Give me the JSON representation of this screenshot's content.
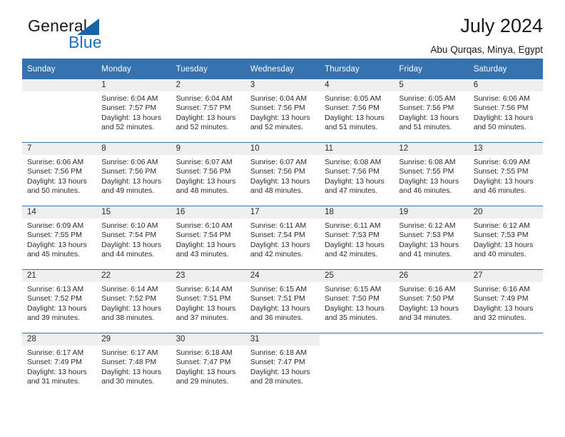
{
  "brand": {
    "name_part1": "General",
    "name_part2": "Blue",
    "triangle_icon": "triangle-icon",
    "accent_color": "#1764ab",
    "text_color": "#1a1a1a"
  },
  "header": {
    "title": "July 2024",
    "location": "Abu Qurqas, Minya, Egypt"
  },
  "theme": {
    "header_blue": "#3572b0",
    "daynum_band": "#efefef",
    "body_text": "#2b2b2b"
  },
  "calendar": {
    "weekday_headers": [
      "Sunday",
      "Monday",
      "Tuesday",
      "Wednesday",
      "Thursday",
      "Friday",
      "Saturday"
    ],
    "labels": {
      "sunrise": "Sunrise:",
      "sunset": "Sunset:",
      "daylight": "Daylight:"
    },
    "weeks": [
      [
        {
          "day": "",
          "sunrise": "",
          "sunset": "",
          "daylight": "",
          "empty": true
        },
        {
          "day": "1",
          "sunrise": "Sunrise: 6:04 AM",
          "sunset": "Sunset: 7:57 PM",
          "daylight": "Daylight: 13 hours and 52 minutes."
        },
        {
          "day": "2",
          "sunrise": "Sunrise: 6:04 AM",
          "sunset": "Sunset: 7:57 PM",
          "daylight": "Daylight: 13 hours and 52 minutes."
        },
        {
          "day": "3",
          "sunrise": "Sunrise: 6:04 AM",
          "sunset": "Sunset: 7:56 PM",
          "daylight": "Daylight: 13 hours and 52 minutes."
        },
        {
          "day": "4",
          "sunrise": "Sunrise: 6:05 AM",
          "sunset": "Sunset: 7:56 PM",
          "daylight": "Daylight: 13 hours and 51 minutes."
        },
        {
          "day": "5",
          "sunrise": "Sunrise: 6:05 AM",
          "sunset": "Sunset: 7:56 PM",
          "daylight": "Daylight: 13 hours and 51 minutes."
        },
        {
          "day": "6",
          "sunrise": "Sunrise: 6:06 AM",
          "sunset": "Sunset: 7:56 PM",
          "daylight": "Daylight: 13 hours and 50 minutes."
        }
      ],
      [
        {
          "day": "7",
          "sunrise": "Sunrise: 6:06 AM",
          "sunset": "Sunset: 7:56 PM",
          "daylight": "Daylight: 13 hours and 50 minutes."
        },
        {
          "day": "8",
          "sunrise": "Sunrise: 6:06 AM",
          "sunset": "Sunset: 7:56 PM",
          "daylight": "Daylight: 13 hours and 49 minutes."
        },
        {
          "day": "9",
          "sunrise": "Sunrise: 6:07 AM",
          "sunset": "Sunset: 7:56 PM",
          "daylight": "Daylight: 13 hours and 48 minutes."
        },
        {
          "day": "10",
          "sunrise": "Sunrise: 6:07 AM",
          "sunset": "Sunset: 7:56 PM",
          "daylight": "Daylight: 13 hours and 48 minutes."
        },
        {
          "day": "11",
          "sunrise": "Sunrise: 6:08 AM",
          "sunset": "Sunset: 7:56 PM",
          "daylight": "Daylight: 13 hours and 47 minutes."
        },
        {
          "day": "12",
          "sunrise": "Sunrise: 6:08 AM",
          "sunset": "Sunset: 7:55 PM",
          "daylight": "Daylight: 13 hours and 46 minutes."
        },
        {
          "day": "13",
          "sunrise": "Sunrise: 6:09 AM",
          "sunset": "Sunset: 7:55 PM",
          "daylight": "Daylight: 13 hours and 46 minutes."
        }
      ],
      [
        {
          "day": "14",
          "sunrise": "Sunrise: 6:09 AM",
          "sunset": "Sunset: 7:55 PM",
          "daylight": "Daylight: 13 hours and 45 minutes."
        },
        {
          "day": "15",
          "sunrise": "Sunrise: 6:10 AM",
          "sunset": "Sunset: 7:54 PM",
          "daylight": "Daylight: 13 hours and 44 minutes."
        },
        {
          "day": "16",
          "sunrise": "Sunrise: 6:10 AM",
          "sunset": "Sunset: 7:54 PM",
          "daylight": "Daylight: 13 hours and 43 minutes."
        },
        {
          "day": "17",
          "sunrise": "Sunrise: 6:11 AM",
          "sunset": "Sunset: 7:54 PM",
          "daylight": "Daylight: 13 hours and 42 minutes."
        },
        {
          "day": "18",
          "sunrise": "Sunrise: 6:11 AM",
          "sunset": "Sunset: 7:53 PM",
          "daylight": "Daylight: 13 hours and 42 minutes."
        },
        {
          "day": "19",
          "sunrise": "Sunrise: 6:12 AM",
          "sunset": "Sunset: 7:53 PM",
          "daylight": "Daylight: 13 hours and 41 minutes."
        },
        {
          "day": "20",
          "sunrise": "Sunrise: 6:12 AM",
          "sunset": "Sunset: 7:53 PM",
          "daylight": "Daylight: 13 hours and 40 minutes."
        }
      ],
      [
        {
          "day": "21",
          "sunrise": "Sunrise: 6:13 AM",
          "sunset": "Sunset: 7:52 PM",
          "daylight": "Daylight: 13 hours and 39 minutes."
        },
        {
          "day": "22",
          "sunrise": "Sunrise: 6:14 AM",
          "sunset": "Sunset: 7:52 PM",
          "daylight": "Daylight: 13 hours and 38 minutes."
        },
        {
          "day": "23",
          "sunrise": "Sunrise: 6:14 AM",
          "sunset": "Sunset: 7:51 PM",
          "daylight": "Daylight: 13 hours and 37 minutes."
        },
        {
          "day": "24",
          "sunrise": "Sunrise: 6:15 AM",
          "sunset": "Sunset: 7:51 PM",
          "daylight": "Daylight: 13 hours and 36 minutes."
        },
        {
          "day": "25",
          "sunrise": "Sunrise: 6:15 AM",
          "sunset": "Sunset: 7:50 PM",
          "daylight": "Daylight: 13 hours and 35 minutes."
        },
        {
          "day": "26",
          "sunrise": "Sunrise: 6:16 AM",
          "sunset": "Sunset: 7:50 PM",
          "daylight": "Daylight: 13 hours and 34 minutes."
        },
        {
          "day": "27",
          "sunrise": "Sunrise: 6:16 AM",
          "sunset": "Sunset: 7:49 PM",
          "daylight": "Daylight: 13 hours and 32 minutes."
        }
      ],
      [
        {
          "day": "28",
          "sunrise": "Sunrise: 6:17 AM",
          "sunset": "Sunset: 7:49 PM",
          "daylight": "Daylight: 13 hours and 31 minutes."
        },
        {
          "day": "29",
          "sunrise": "Sunrise: 6:17 AM",
          "sunset": "Sunset: 7:48 PM",
          "daylight": "Daylight: 13 hours and 30 minutes."
        },
        {
          "day": "30",
          "sunrise": "Sunrise: 6:18 AM",
          "sunset": "Sunset: 7:47 PM",
          "daylight": "Daylight: 13 hours and 29 minutes."
        },
        {
          "day": "31",
          "sunrise": "Sunrise: 6:18 AM",
          "sunset": "Sunset: 7:47 PM",
          "daylight": "Daylight: 13 hours and 28 minutes."
        },
        {
          "day": "",
          "sunrise": "",
          "sunset": "",
          "daylight": "",
          "blank": true
        },
        {
          "day": "",
          "sunrise": "",
          "sunset": "",
          "daylight": "",
          "blank": true
        },
        {
          "day": "",
          "sunrise": "",
          "sunset": "",
          "daylight": "",
          "blank": true
        }
      ]
    ]
  }
}
